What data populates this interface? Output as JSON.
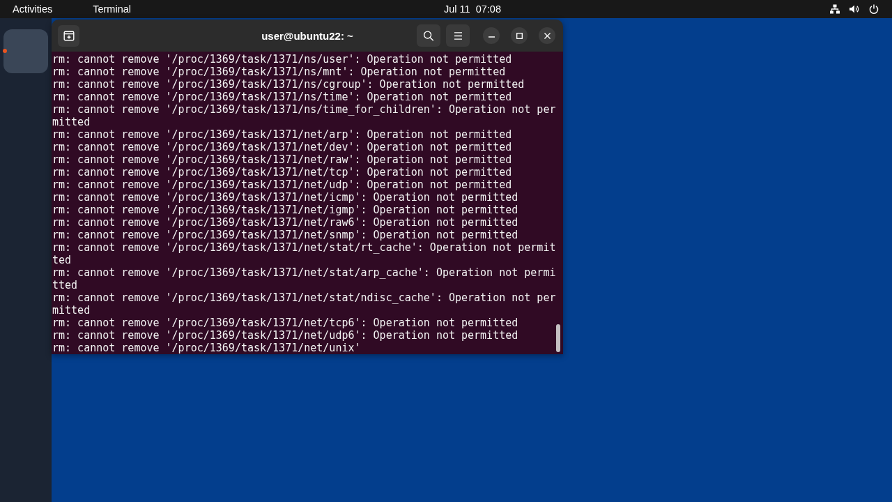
{
  "top_bar": {
    "activities": "Activities",
    "app_menu": "Terminal",
    "clock": "Jul 11  07:08"
  },
  "dock": {
    "apps": [
      {
        "focused": true,
        "running": true
      }
    ]
  },
  "terminal": {
    "title": "user@ubuntu22: ~",
    "lines": [
      "rm: cannot remove '/proc/1369/task/1371/ns/user': Operation not permitted",
      "rm: cannot remove '/proc/1369/task/1371/ns/mnt': Operation not permitted",
      "rm: cannot remove '/proc/1369/task/1371/ns/cgroup': Operation not permitted",
      "rm: cannot remove '/proc/1369/task/1371/ns/time': Operation not permitted",
      "rm: cannot remove '/proc/1369/task/1371/ns/time_for_children': Operation not permitted",
      "rm: cannot remove '/proc/1369/task/1371/net/arp': Operation not permitted",
      "rm: cannot remove '/proc/1369/task/1371/net/dev': Operation not permitted",
      "rm: cannot remove '/proc/1369/task/1371/net/raw': Operation not permitted",
      "rm: cannot remove '/proc/1369/task/1371/net/tcp': Operation not permitted",
      "rm: cannot remove '/proc/1369/task/1371/net/udp': Operation not permitted",
      "rm: cannot remove '/proc/1369/task/1371/net/icmp': Operation not permitted",
      "rm: cannot remove '/proc/1369/task/1371/net/igmp': Operation not permitted",
      "rm: cannot remove '/proc/1369/task/1371/net/raw6': Operation not permitted",
      "rm: cannot remove '/proc/1369/task/1371/net/snmp': Operation not permitted",
      "rm: cannot remove '/proc/1369/task/1371/net/stat/rt_cache': Operation not permitted",
      "rm: cannot remove '/proc/1369/task/1371/net/stat/arp_cache': Operation not permitted",
      "rm: cannot remove '/proc/1369/task/1371/net/stat/ndisc_cache': Operation not permitted",
      "rm: cannot remove '/proc/1369/task/1371/net/tcp6': Operation not permitted",
      "rm: cannot remove '/proc/1369/task/1371/net/udp6': Operation not permitted",
      "rm: cannot remove '/proc/1369/task/1371/net/unix'"
    ]
  }
}
